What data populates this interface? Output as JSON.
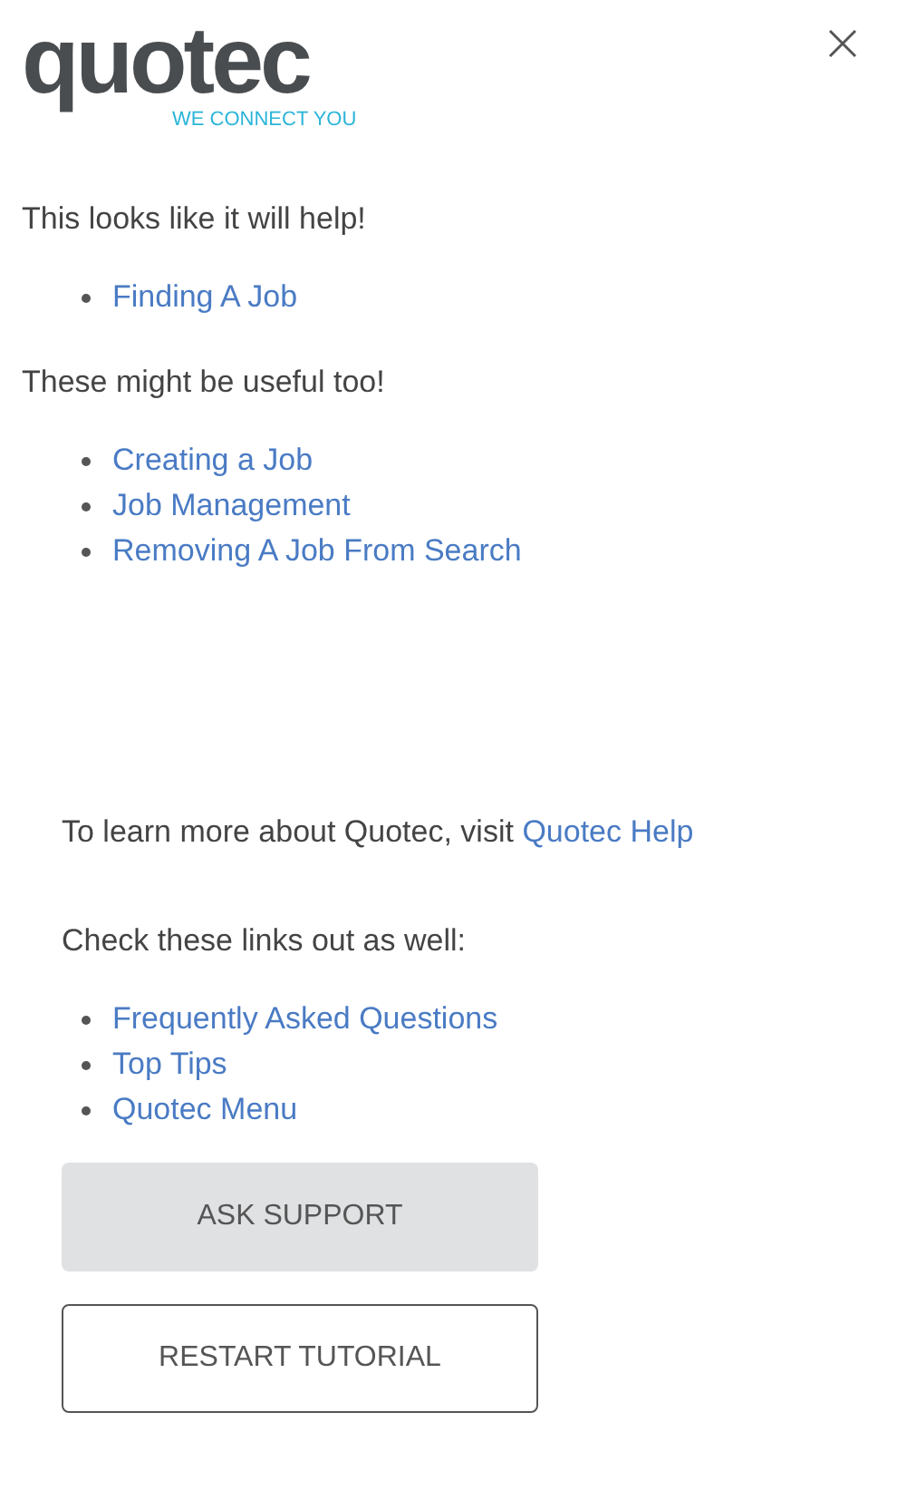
{
  "logo": {
    "wordmark": "quotec",
    "tagline": "WE CONNECT YOU"
  },
  "top_heading": "This looks like it will help!",
  "top_links": [
    "Finding A Job"
  ],
  "more_heading": "These might be useful too!",
  "more_links": [
    "Creating a Job",
    "Job Management",
    "Removing A Job From Search"
  ],
  "learn_more": {
    "text": "To learn more about Quotec, visit",
    "link": "Quotec Help"
  },
  "check_heading": "Check these links out as well:",
  "check_links": [
    "Frequently Asked Questions",
    "Top Tips",
    "Quotec Menu"
  ],
  "buttons": [
    {
      "label": "ASK SUPPORT",
      "kind": "filled"
    },
    {
      "label": "RESTART TUTORIAL",
      "kind": "outline"
    }
  ]
}
